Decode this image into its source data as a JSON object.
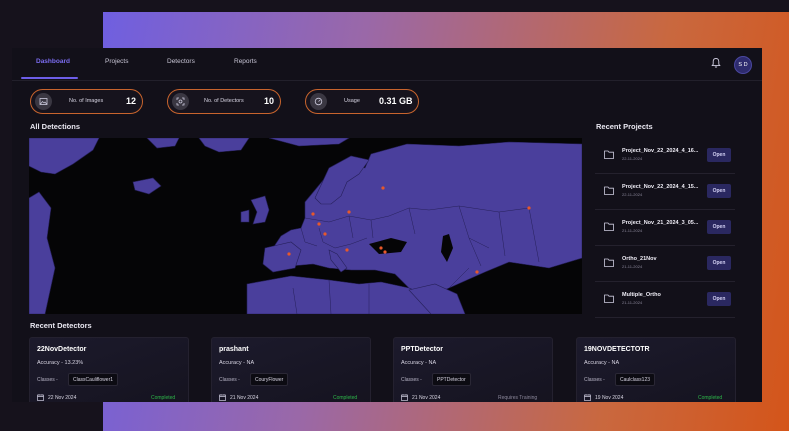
{
  "nav": {
    "tabs": [
      "Dashboard",
      "Projects",
      "Detectors",
      "Reports"
    ],
    "active": "Dashboard",
    "user_initials": "S D"
  },
  "stats": [
    {
      "label": "No. of Images",
      "value": "12",
      "icon": "images-icon"
    },
    {
      "label": "No. of Detectors",
      "value": "10",
      "icon": "detector-icon"
    },
    {
      "label": "Usage",
      "value": "0.31 GB",
      "icon": "usage-gauge-icon"
    }
  ],
  "sections": {
    "detections": "All Detections",
    "projects": "Recent Projects",
    "detectors": "Recent Detectors"
  },
  "colors": {
    "accent": "#6d5ee8",
    "stat_border": "#c8642d",
    "map_land": "#4a3f9c",
    "marker": "#e8582a",
    "completed": "#2db84a",
    "requires_training": "#8b879a"
  },
  "recent_projects": [
    {
      "name": "Project_Nov_22_2024_4_16...",
      "date": "22-11-2024",
      "action": "Open"
    },
    {
      "name": "Project_Nov_22_2024_4_15...",
      "date": "22-11-2024",
      "action": "Open"
    },
    {
      "name": "Project_Nov_21_2024_3_05...",
      "date": "21-11-2024",
      "action": "Open"
    },
    {
      "name": "Ortho_21Nov",
      "date": "21-11-2024",
      "action": "Open"
    },
    {
      "name": "Multiple_Ortho",
      "date": "21-11-2024",
      "action": "Open"
    }
  ],
  "detectors": [
    {
      "name": "22NovDetector",
      "accuracy": "Accuracy - 13.23%",
      "classes_label": "Classes -",
      "class": "ClassCauliflower1",
      "date": "22 Nov 2024",
      "status": "Completed"
    },
    {
      "name": "prashant",
      "accuracy": "Accuracy - NA",
      "classes_label": "Classes -",
      "class": "CouryFlower",
      "date": "21 Nov 2024",
      "status": "Completed"
    },
    {
      "name": "PPTDetector",
      "accuracy": "Accuracy - NA",
      "classes_label": "Classes -",
      "class": "PPTDetector",
      "date": "21 Nov 2024",
      "status": "Requires Training"
    },
    {
      "name": "19NOVDETECTOTR",
      "accuracy": "Accuracy - NA",
      "classes_label": "Classes -",
      "class": "Caulclass123",
      "date": "19 Nov 2024",
      "status": "Completed"
    }
  ]
}
